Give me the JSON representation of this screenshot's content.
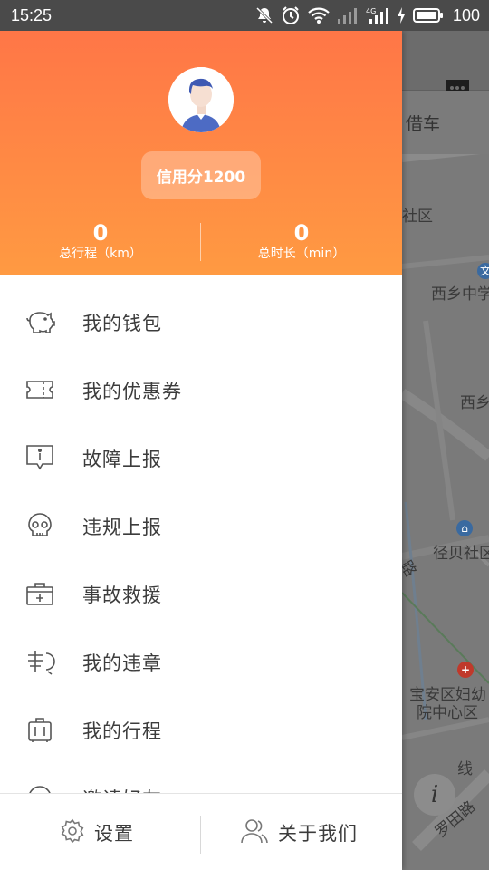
{
  "status_bar": {
    "time": "15:25",
    "battery_percent": "100",
    "icons": [
      "bell-muted-icon",
      "alarm-icon",
      "wifi-icon",
      "signal-weak-icon",
      "signal-4g-icon",
      "charging-icon",
      "battery-icon"
    ]
  },
  "map": {
    "search_hint": "借车",
    "labels": [
      "社区",
      "西乡中学",
      "西乡",
      "径贝社区",
      "宝安区妇幼",
      "院中心区",
      "罗田路",
      "路",
      "线"
    ],
    "colors": {
      "map_bg": "#7a7a7a",
      "road": "#8a8a8a"
    }
  },
  "drawer": {
    "header": {
      "credit_label": "信用分1200",
      "stats": [
        {
          "value": "0",
          "label": "总行程（km）"
        },
        {
          "value": "0",
          "label": "总时长（min）"
        }
      ],
      "gradient": [
        "#ff7647",
        "#ff9a42"
      ]
    },
    "menu": [
      {
        "icon": "piggy-bank-icon",
        "label": "我的钱包"
      },
      {
        "icon": "coupon-ticket-icon",
        "label": "我的优惠券"
      },
      {
        "icon": "info-bubble-icon",
        "label": "故障上报"
      },
      {
        "icon": "skull-icon",
        "label": "违规上报"
      },
      {
        "icon": "first-aid-kit-icon",
        "label": "事故救援"
      },
      {
        "icon": "violation-icon",
        "label": "我的违章"
      },
      {
        "icon": "luggage-icon",
        "label": "我的行程"
      },
      {
        "icon": "partial-icon",
        "label": "邀请好友"
      }
    ],
    "footer": {
      "settings_label": "设置",
      "about_label": "关于我们"
    }
  }
}
